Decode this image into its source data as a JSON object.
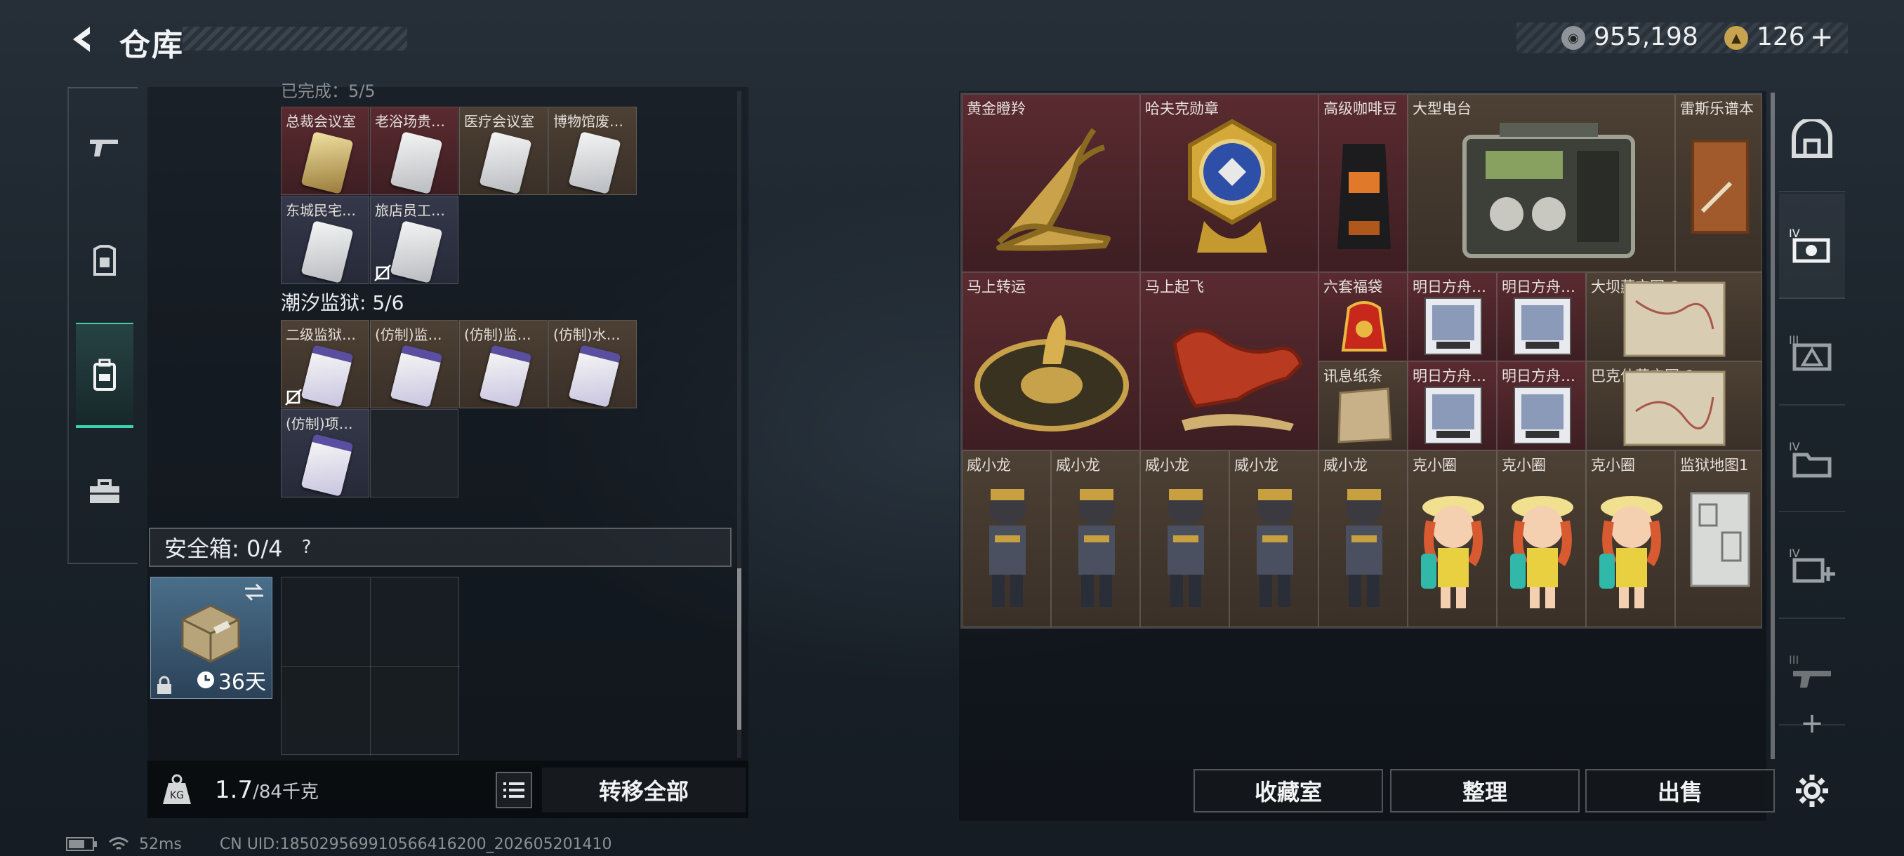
{
  "header": {
    "title": "仓库"
  },
  "currency": {
    "coins": "955,198",
    "tokens": "126",
    "add_symbol": "+"
  },
  "left_nav": {
    "items": [
      {
        "icon": "gun-icon"
      },
      {
        "icon": "armor-icon"
      },
      {
        "icon": "backpack-icon",
        "active": true
      },
      {
        "icon": "toolbox-icon"
      }
    ]
  },
  "key_sections": {
    "partial_label": "已完成：5/5",
    "row1": [
      {
        "label": "总裁会议室",
        "color": "red",
        "card": "gold"
      },
      {
        "label": "老浴场贵…",
        "color": "red",
        "card": "white"
      },
      {
        "label": "医疗会议室",
        "color": "brown",
        "card": "white"
      },
      {
        "label": "博物馆废…",
        "color": "brown",
        "card": "white"
      }
    ],
    "row2": [
      {
        "label": "东城民宅…",
        "color": "blue",
        "card": "white"
      },
      {
        "label": "旅店员工…",
        "color": "blue",
        "card": "white",
        "no_transfer": true
      }
    ],
    "prison_label": "潮汐监狱: 5/6",
    "row3": [
      {
        "label": "二级监狱…",
        "color": "brown",
        "card": "purple",
        "no_transfer": true
      },
      {
        "label": "(仿制)监…",
        "color": "brown",
        "card": "purple"
      },
      {
        "label": "(仿制)监…",
        "color": "brown",
        "card": "purple"
      },
      {
        "label": "(仿制)水…",
        "color": "brown",
        "card": "purple"
      }
    ],
    "row4": [
      {
        "label": "(仿制)项…",
        "color": "blue",
        "card": "purple"
      }
    ]
  },
  "safebox": {
    "label": "安全箱: 0/4",
    "help": "?",
    "days": "36天"
  },
  "left_bottom": {
    "weight_current": "1.7",
    "weight_max": "/84千克",
    "transfer_all": "转移全部"
  },
  "storage": {
    "items": [
      {
        "label": "黄金瞪羚",
        "color": "red"
      },
      {
        "label": "哈夫克勋章",
        "color": "red"
      },
      {
        "label": "高级咖啡豆",
        "color": "red"
      },
      {
        "label": "大型电台",
        "color": "brown"
      },
      {
        "label": "雷斯乐谱本",
        "color": "brown"
      },
      {
        "label": "马上转运",
        "color": "red"
      },
      {
        "label": "马上起飞",
        "color": "red"
      },
      {
        "label": "六套福袋",
        "color": "red"
      },
      {
        "label": "明日方舟…",
        "color": "red"
      },
      {
        "label": "明日方舟…",
        "color": "red"
      },
      {
        "label": "大坝藏宝图-8",
        "color": "brown"
      },
      {
        "label": "讯息纸条",
        "color": "brown"
      },
      {
        "label": "明日方舟…",
        "color": "red"
      },
      {
        "label": "明日方舟…",
        "color": "red"
      },
      {
        "label": "巴克什藏宝图-8",
        "color": "brown"
      },
      {
        "label": "威小龙",
        "color": "brown"
      },
      {
        "label": "威小龙",
        "color": "brown"
      },
      {
        "label": "威小龙",
        "color": "brown"
      },
      {
        "label": "威小龙",
        "color": "brown"
      },
      {
        "label": "威小龙",
        "color": "brown"
      },
      {
        "label": "克小圈",
        "color": "brown"
      },
      {
        "label": "克小圈",
        "color": "brown"
      },
      {
        "label": "克小圈",
        "color": "brown"
      },
      {
        "label": "监狱地图1",
        "color": "brown"
      }
    ]
  },
  "right_nav": {
    "items": [
      {
        "icon": "vault-icon"
      },
      {
        "icon": "tier-iv-camera-icon",
        "tier": "IV"
      },
      {
        "icon": "tier-iii-warning-icon",
        "tier": "III"
      },
      {
        "icon": "tier-iv-folder-icon",
        "tier": "IV"
      },
      {
        "icon": "tier-iv-medkit-icon",
        "tier": "IV"
      },
      {
        "icon": "tier-iii-gun-icon",
        "tier": "III"
      }
    ],
    "add": "+"
  },
  "bottom_buttons": {
    "collection": "收藏室",
    "organize": "整理",
    "sell": "出售"
  },
  "status": {
    "ping": "52ms",
    "uid": "CN UID:18502956991056641620​0_202605201410"
  },
  "colors": {
    "accent": "#3fd0b0",
    "cell_red": "#5a2b30",
    "cell_brown": "#4d4034",
    "cell_blue": "#34384a"
  }
}
